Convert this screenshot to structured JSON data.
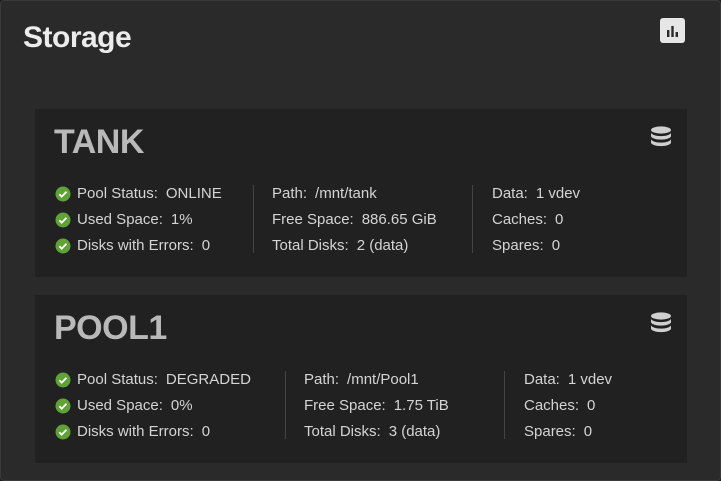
{
  "widget": {
    "title": "Storage",
    "report_icon": "bar-chart-icon",
    "pool_icon": "database-icon",
    "status_icon": "check-circle-icon",
    "colors": {
      "ok": "#5fa336",
      "background": "#2a2a2a",
      "card": "#212121"
    }
  },
  "pools": [
    {
      "name": "TANK",
      "pool_status_label": "Pool Status:",
      "pool_status": "ONLINE",
      "used_space_label": "Used Space:",
      "used_space": "1%",
      "disks_errors_label": "Disks with Errors:",
      "disks_errors": "0",
      "path_label": "Path:",
      "path": "/mnt/tank",
      "free_space_label": "Free Space:",
      "free_space": "886.65 GiB",
      "total_disks_label": "Total Disks:",
      "total_disks": "2 (data)",
      "data_label": "Data:",
      "data": "1 vdev",
      "caches_label": "Caches:",
      "caches": "0",
      "spares_label": "Spares:",
      "spares": "0"
    },
    {
      "name": "POOL1",
      "pool_status_label": "Pool Status:",
      "pool_status": "DEGRADED",
      "used_space_label": "Used Space:",
      "used_space": "0%",
      "disks_errors_label": "Disks with Errors:",
      "disks_errors": "0",
      "path_label": "Path:",
      "path": "/mnt/Pool1",
      "free_space_label": "Free Space:",
      "free_space": "1.75 TiB",
      "total_disks_label": "Total Disks:",
      "total_disks": "3 (data)",
      "data_label": "Data:",
      "data": "1 vdev",
      "caches_label": "Caches:",
      "caches": "0",
      "spares_label": "Spares:",
      "spares": "0"
    }
  ]
}
